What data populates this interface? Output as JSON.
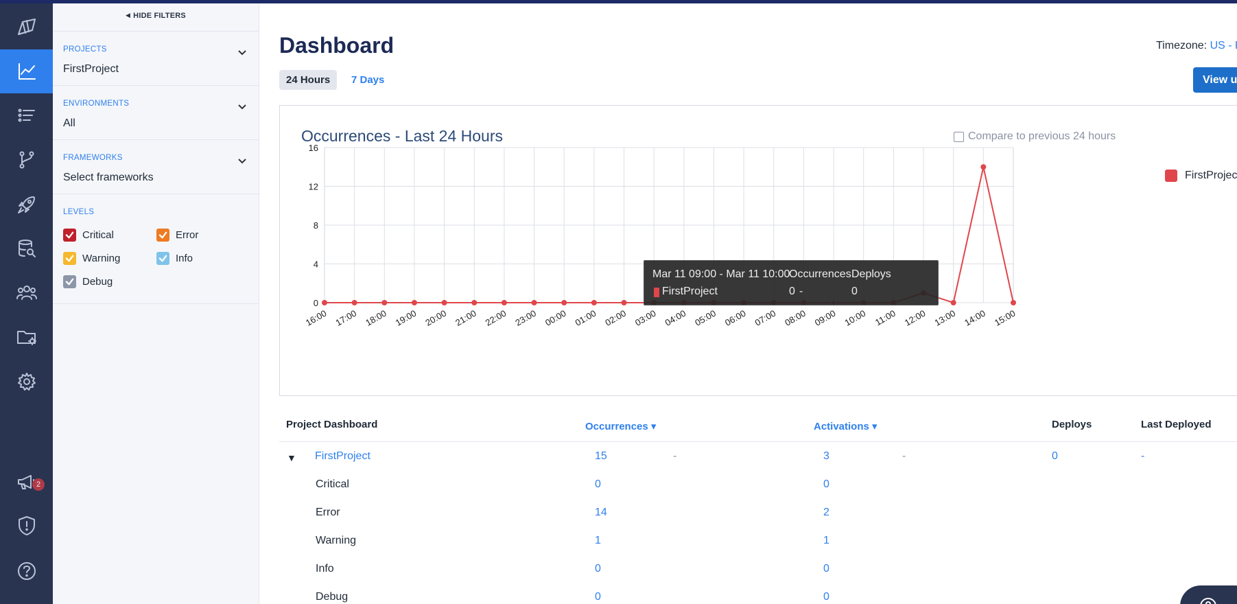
{
  "filters": {
    "hide_label": "HIDE FILTERS",
    "sections": [
      {
        "title": "PROJECTS",
        "value": "FirstProject"
      },
      {
        "title": "ENVIRONMENTS",
        "value": "All"
      },
      {
        "title": "FRAMEWORKS",
        "value": "Select frameworks"
      }
    ],
    "levels_title": "LEVELS",
    "levels": [
      {
        "label": "Critical",
        "color": "#c0202a"
      },
      {
        "label": "Error",
        "color": "#ee7a22"
      },
      {
        "label": "Warning",
        "color": "#f5b82e"
      },
      {
        "label": "Info",
        "color": "#7fc3ea"
      },
      {
        "label": "Debug",
        "color": "#8c96a8"
      }
    ]
  },
  "nav": {
    "icons": [
      "logo-icon",
      "dashboard-icon",
      "items-icon",
      "versions-icon",
      "deploys-icon",
      "rql-icon",
      "people-icon",
      "projects-icon",
      "settings-icon",
      "announcements-icon",
      "security-icon",
      "help-icon"
    ],
    "notification_count": "2",
    "active_color": "#2f80ed"
  },
  "header": {
    "title": "Dashboard",
    "timezone_label": "Timezone:",
    "timezone_value": "US - P",
    "range_24h": "24 Hours",
    "range_7d": "7 Days",
    "view_button": "View u"
  },
  "chart": {
    "title": "Occurrences - Last 24 Hours",
    "compare_label": "Compare to previous 24 hours",
    "tooltip": {
      "range": "Mar 11 09:00 - Mar 11 10:00",
      "col_occurrences": "Occurrences",
      "col_deploys": "Deploys",
      "project": "FirstProject",
      "occurrences": "0",
      "occurrences_extra": "-",
      "deploys": "0"
    }
  },
  "chart_data": {
    "type": "line",
    "x": [
      "16:00",
      "17:00",
      "18:00",
      "19:00",
      "20:00",
      "21:00",
      "22:00",
      "23:00",
      "00:00",
      "01:00",
      "02:00",
      "03:00",
      "04:00",
      "05:00",
      "06:00",
      "07:00",
      "08:00",
      "09:00",
      "10:00",
      "11:00",
      "12:00",
      "13:00",
      "14:00",
      "15:00"
    ],
    "series": [
      {
        "name": "FirstProject",
        "color": "#e0464b",
        "values": [
          0,
          0,
          0,
          0,
          0,
          0,
          0,
          0,
          0,
          0,
          0,
          0,
          0,
          0,
          0,
          0,
          0,
          0,
          0,
          0,
          1,
          0,
          14,
          0
        ]
      }
    ],
    "yticks": [
      0,
      4,
      8,
      12,
      16
    ],
    "ylim": [
      0,
      16
    ],
    "grid": true,
    "legend": "right"
  },
  "table": {
    "headers": {
      "project": "Project Dashboard",
      "occurrences": "Occurrences ▾",
      "activations": "Activations ▾",
      "deploys": "Deploys",
      "last_deployed": "Last Deployed"
    },
    "expand_glyph": "▼",
    "project_row": {
      "name": "FirstProject",
      "occurrences": "15",
      "occ_trend": "-",
      "activations": "3",
      "act_trend": "-",
      "deploys": "0",
      "last_deployed": "-"
    },
    "levels": [
      {
        "label": "Critical",
        "occurrences": "0",
        "activations": "0"
      },
      {
        "label": "Error",
        "occurrences": "14",
        "activations": "2"
      },
      {
        "label": "Warning",
        "occurrences": "1",
        "activations": "1"
      },
      {
        "label": "Info",
        "occurrences": "0",
        "activations": "0"
      },
      {
        "label": "Debug",
        "occurrences": "0",
        "activations": "0"
      }
    ]
  }
}
